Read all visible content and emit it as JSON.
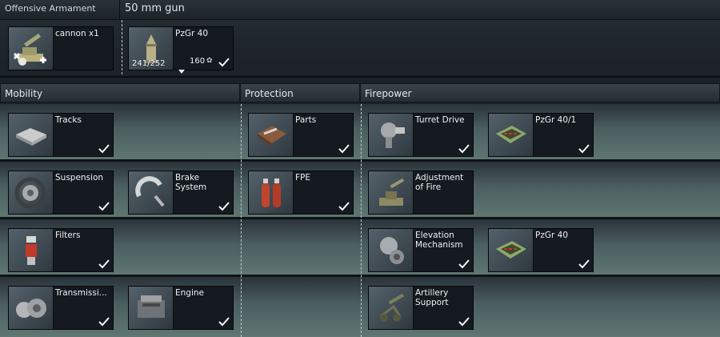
{
  "armament": {
    "header_label": "Offensive Armament",
    "gun_label": "50 mm gun",
    "cannon": {
      "name": "cannon x1",
      "icon": "cannon-icon"
    },
    "ammo": {
      "name": "PzGr 40",
      "quantity": "241/252",
      "count": "160",
      "icon": "shell-icon"
    }
  },
  "sections": {
    "mobility": "Mobility",
    "protection": "Protection",
    "firepower": "Firepower"
  },
  "modules": {
    "tracks": "Tracks",
    "suspension": "Suspension",
    "brake_system": "Brake System",
    "filters": "Filters",
    "transmission": "Transmissi...",
    "engine": "Engine",
    "parts": "Parts",
    "fpe": "FPE",
    "turret_drive": "Turret Drive",
    "pzgr_40_1": "PzGr 40/1",
    "adjustment_of_fire": "Adjustment of Fire",
    "elevation_mechanism": "Elevation Mechanism",
    "pzgr_40": "PzGr 40",
    "artillery_support": "Artillery Support"
  },
  "colors": {
    "row_top": "#2a3339",
    "row_bottom": "#5f7672",
    "card_bg": "#141a1f",
    "text": "#eef1f3"
  }
}
